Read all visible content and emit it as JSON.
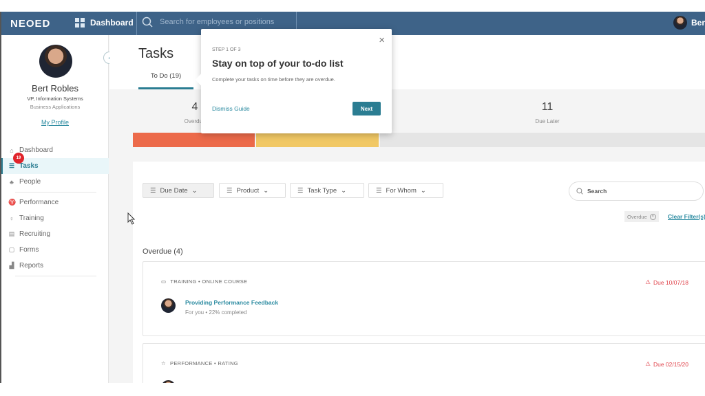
{
  "header": {
    "logo": "NEOED",
    "dashboard": "Dashboard",
    "search_placeholder": "Search for employees or positions",
    "user": "Bert"
  },
  "profile": {
    "name": "Bert Robles",
    "title": "VP, Information Systems",
    "department": "Business Applications",
    "link": "My Profile"
  },
  "sidebar": {
    "items": [
      {
        "label": "Dashboard",
        "icon": "home-icon"
      },
      {
        "label": "Tasks",
        "icon": "list-icon",
        "badge": "19",
        "active": true
      },
      {
        "label": "People",
        "icon": "org-chart-icon"
      },
      {
        "label": "Performance",
        "icon": "trophy-icon"
      },
      {
        "label": "Training",
        "icon": "lightbulb-icon"
      },
      {
        "label": "Recruiting",
        "icon": "document-icon"
      },
      {
        "label": "Forms",
        "icon": "form-icon"
      },
      {
        "label": "Reports",
        "icon": "bar-chart-icon"
      }
    ]
  },
  "page": {
    "title": "Tasks",
    "tab": "To Do (19)"
  },
  "stats": [
    {
      "value": "4",
      "label": "Overdue",
      "color": "#ec6a4a"
    },
    {
      "value": "11",
      "label": "Due Later",
      "color": "#e5e5e5"
    }
  ],
  "progress": {
    "overdue_fraction": 0.21,
    "due_soon_fraction": 0.21,
    "colors": [
      "#ec6a4a",
      "#f1c865",
      "#e5e5e5"
    ]
  },
  "filters": [
    "Due Date",
    "Product",
    "Task Type",
    "For Whom"
  ],
  "search_placeholder": "Search",
  "active_filter": "Overdue",
  "clear_filters": "Clear Filter(s)",
  "section": "Overdue (4)",
  "tasks": [
    {
      "type": "TRAINING • ONLINE COURSE",
      "due": "Due 10/07/18",
      "title": "Providing Performance Feedback",
      "subtitle": "For you • 22% completed"
    },
    {
      "type": "PERFORMANCE • RATING",
      "due": "Due 02/15/20"
    }
  ],
  "guide": {
    "step": "STEP 1 OF 3",
    "title": "Stay on top of your to-do list",
    "description": "Complete your tasks on time before they are overdue.",
    "dismiss": "Dismiss Guide",
    "next": "Next"
  }
}
